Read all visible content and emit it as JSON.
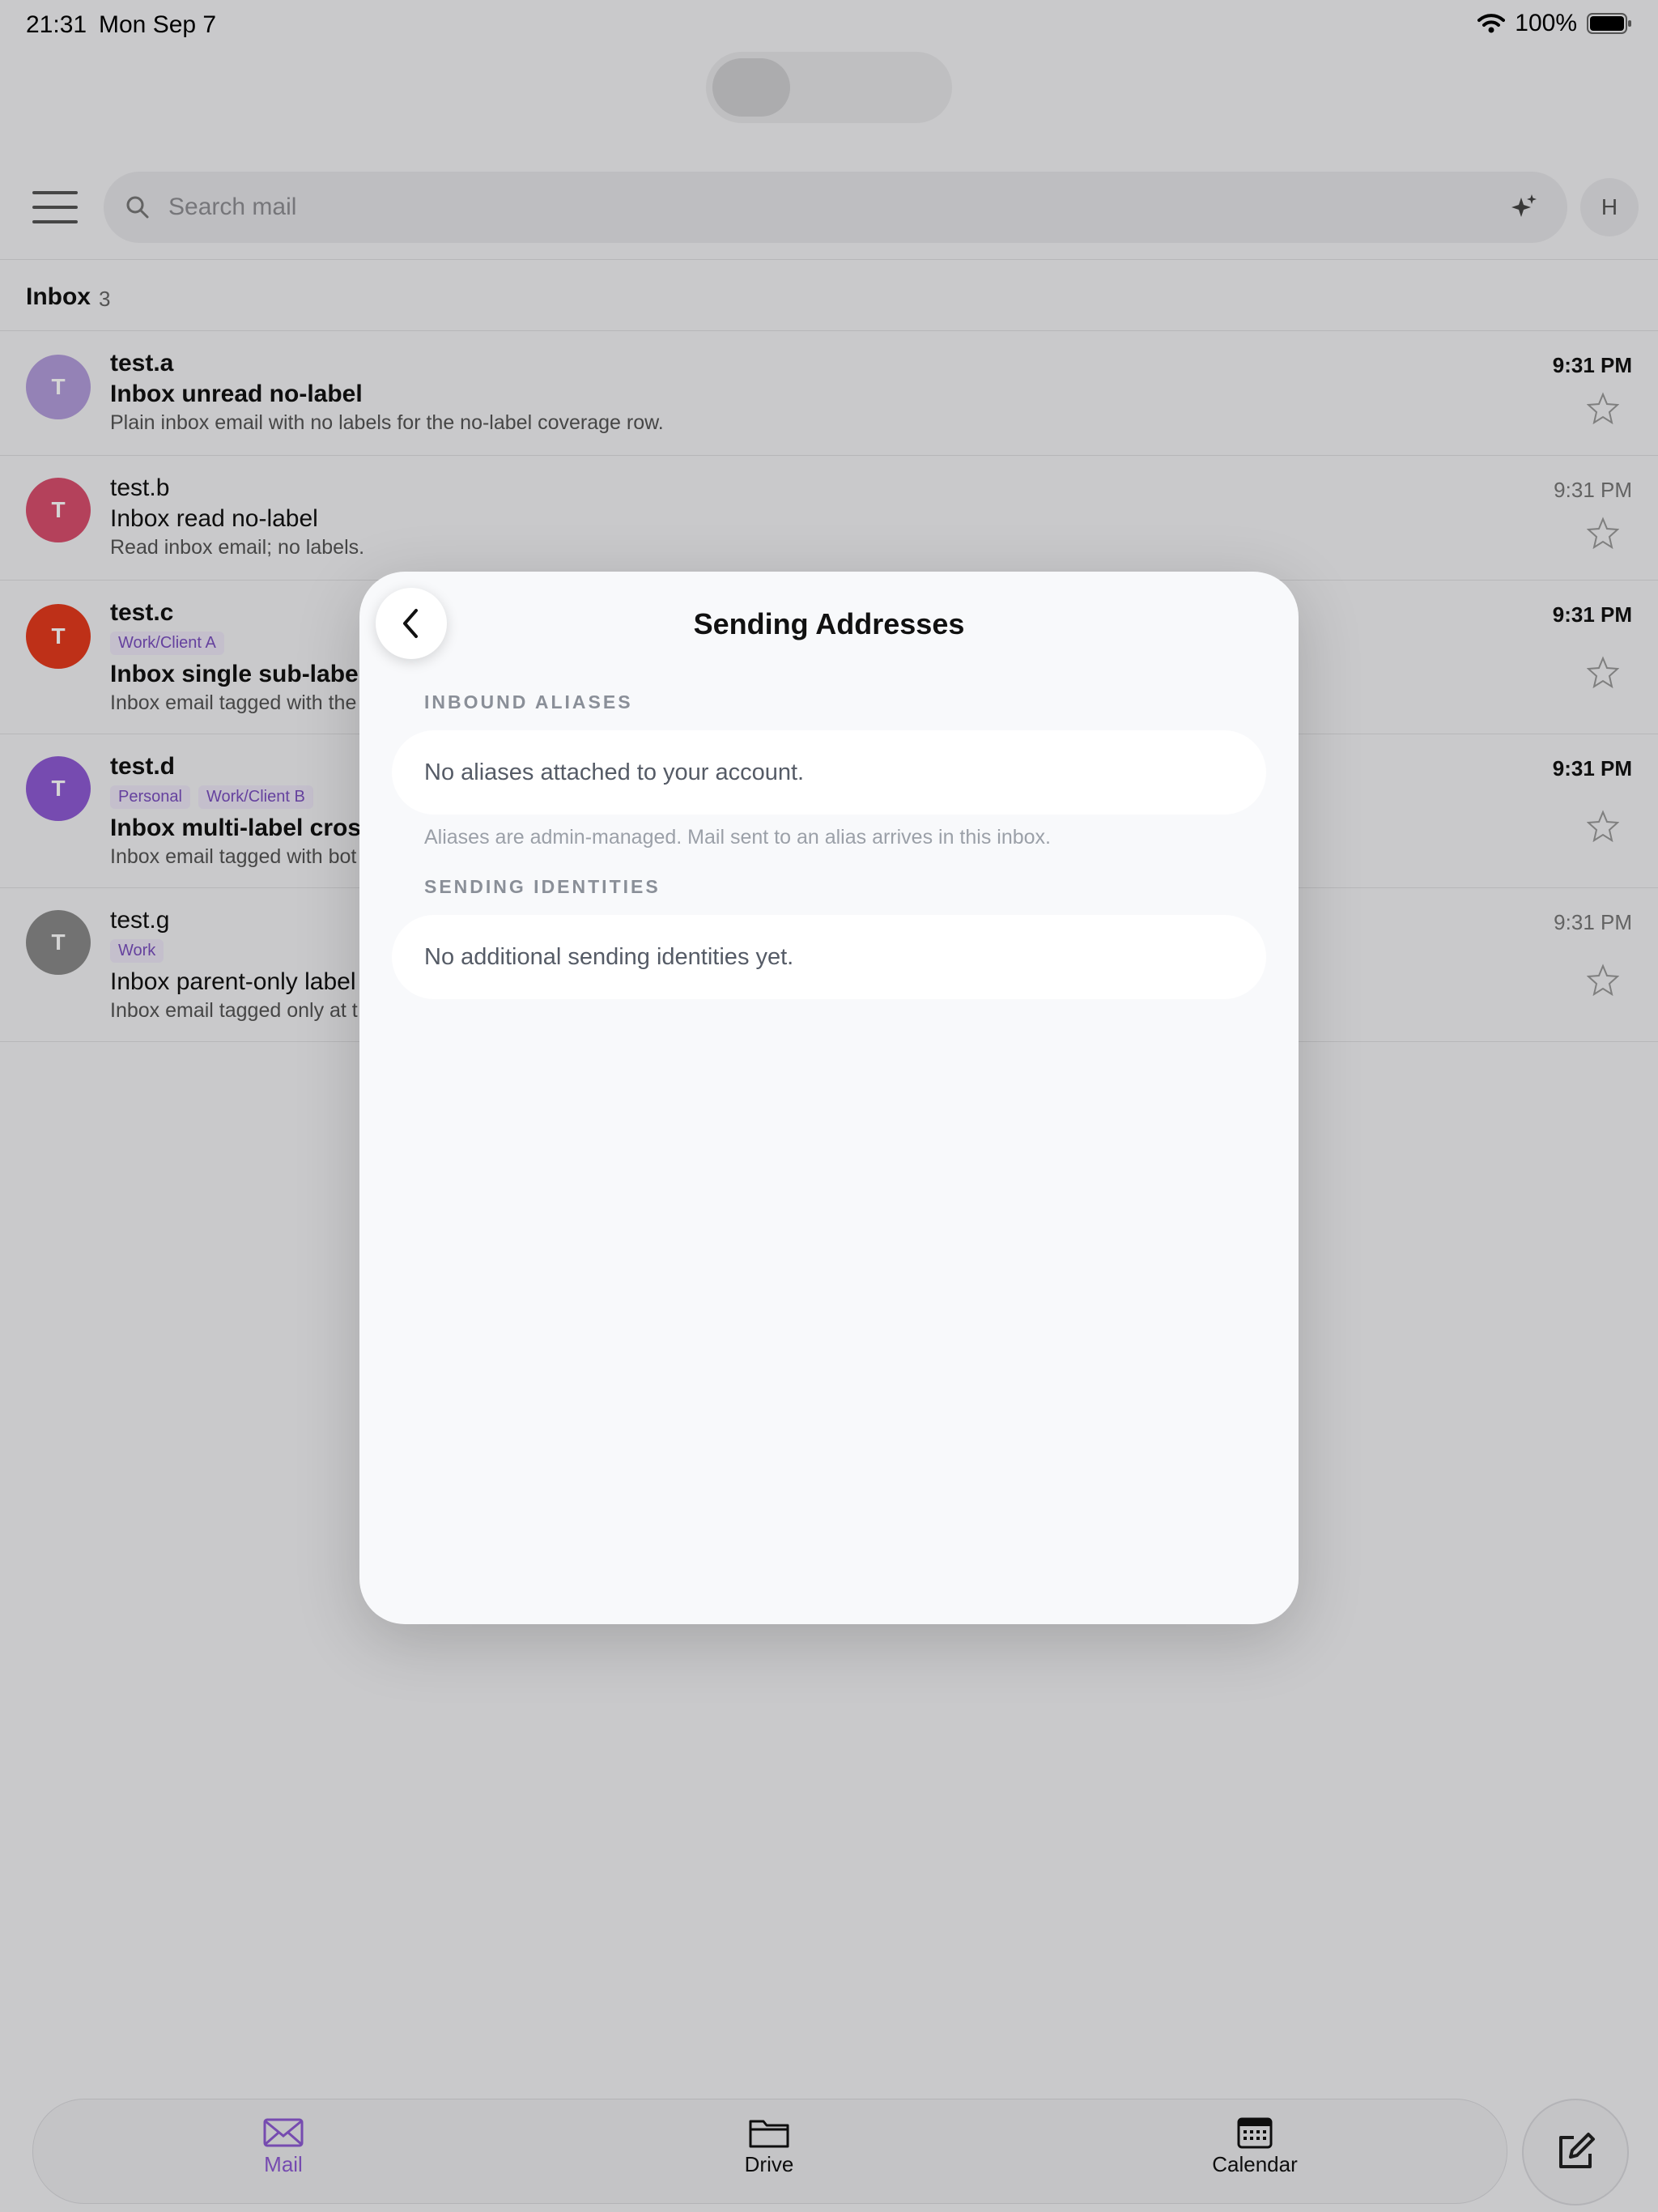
{
  "status_bar": {
    "time": "21:31",
    "date": "Mon Sep 7",
    "battery": "100%"
  },
  "search": {
    "placeholder": "Search mail",
    "avatar_initial": "H"
  },
  "inbox": {
    "title": "Inbox",
    "count": "3"
  },
  "emails": [
    {
      "initial": "T",
      "avatar_color": "#b39ddb",
      "sender": "test.a",
      "subject": "Inbox unread no-label",
      "preview": "Plain inbox email with no labels for the no-label coverage row.",
      "time": "9:31 PM",
      "unread": true,
      "tags": []
    },
    {
      "initial": "T",
      "avatar_color": "#d94f6e",
      "sender": "test.b",
      "subject": "Inbox read no-label",
      "preview": "Read inbox email; no labels.",
      "time": "9:31 PM",
      "unread": false,
      "tags": []
    },
    {
      "initial": "T",
      "avatar_color": "#e53a1e",
      "sender": "test.c",
      "subject": "Inbox single sub-label",
      "preview": "Inbox email tagged with the",
      "time": "9:31 PM",
      "unread": true,
      "tags": [
        "Work/Client A"
      ]
    },
    {
      "initial": "T",
      "avatar_color": "#8e5bd4",
      "sender": "test.d",
      "subject": "Inbox multi-label cross",
      "preview": "Inbox email tagged with bot",
      "time": "9:31 PM",
      "unread": true,
      "tags": [
        "Personal",
        "Work/Client B"
      ]
    },
    {
      "initial": "T",
      "avatar_color": "#8a8a8a",
      "sender": "test.g",
      "subject": "Inbox parent-only label",
      "preview": "Inbox email tagged only at t",
      "time": "9:31 PM",
      "unread": false,
      "tags": [
        "Work"
      ]
    }
  ],
  "modal": {
    "title": "Sending Addresses",
    "inbound_label": "INBOUND ALIASES",
    "inbound_empty": "No aliases attached to your account.",
    "inbound_helper": "Aliases are admin-managed. Mail sent to an alias arrives in this inbox.",
    "identities_label": "SENDING IDENTITIES",
    "identities_empty": "No additional sending identities yet."
  },
  "tabs": [
    {
      "label": "Mail",
      "icon": "mail-icon",
      "active": true
    },
    {
      "label": "Drive",
      "icon": "folder-icon",
      "active": false
    },
    {
      "label": "Calendar",
      "icon": "calendar-icon",
      "active": false
    }
  ],
  "colors": {
    "accent": "#8e5bd4",
    "overlay": "rgba(0,0,0,0.17)"
  }
}
